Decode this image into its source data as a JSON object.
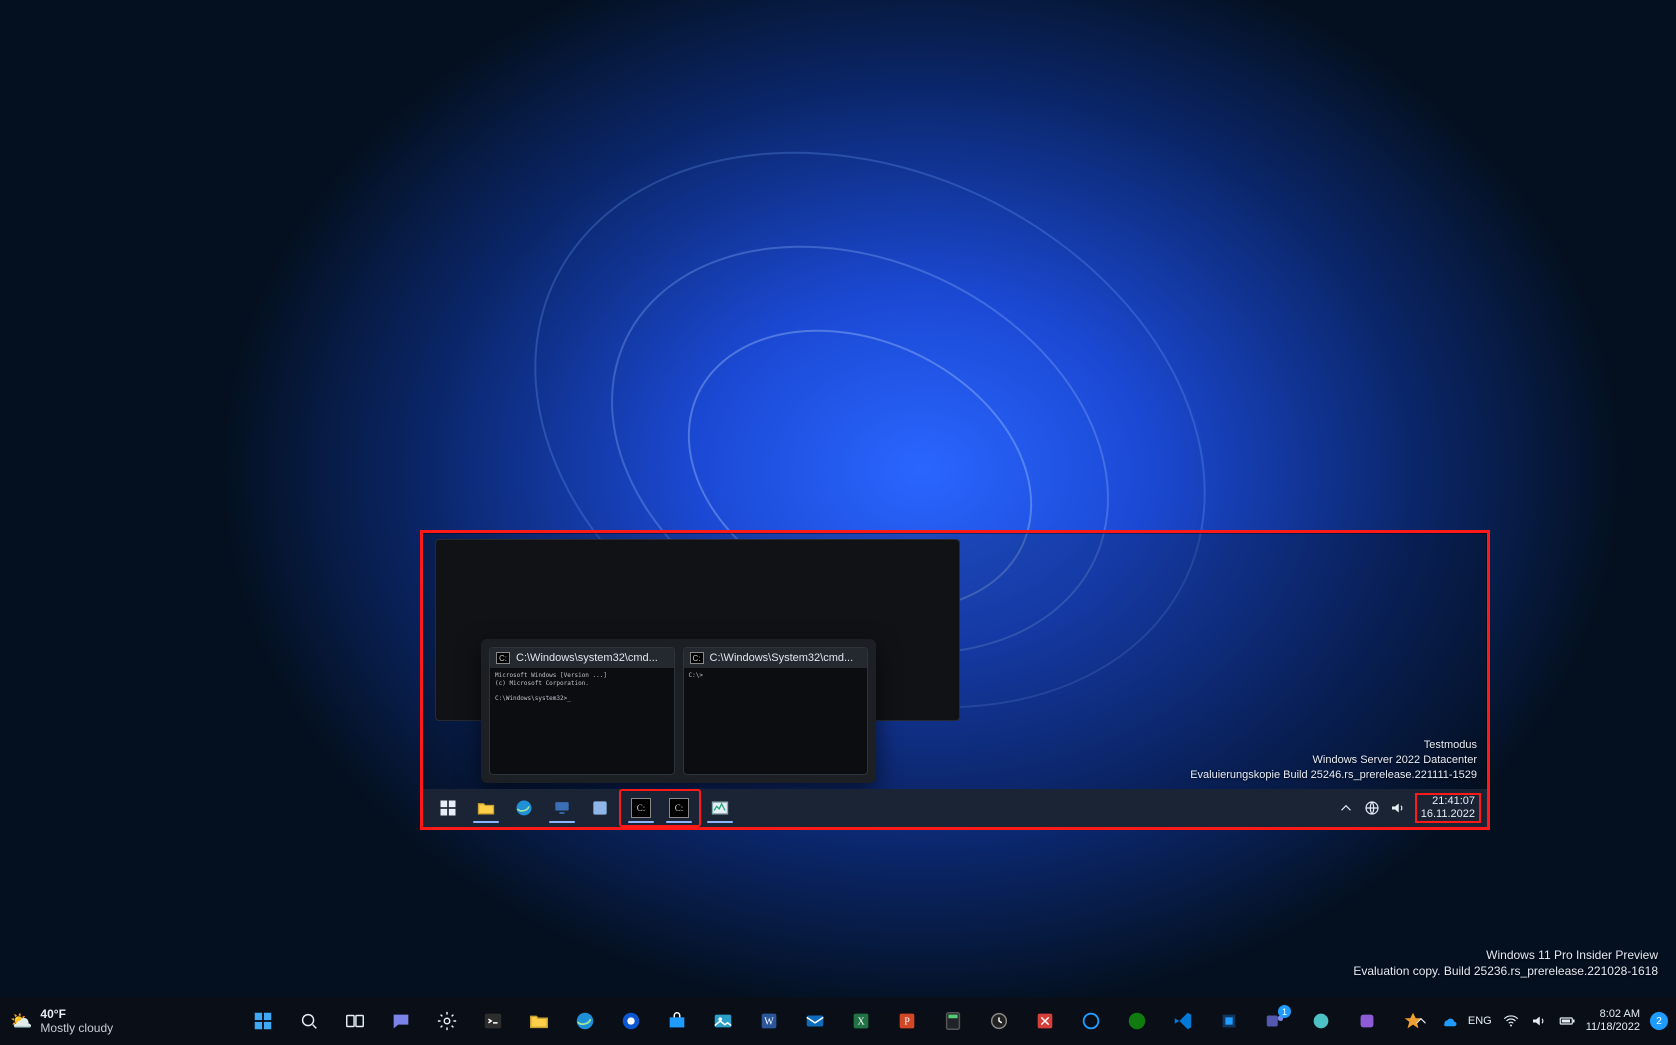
{
  "host": {
    "weather_temp": "40°F",
    "weather_desc": "Mostly cloudy",
    "watermark_line1": "Windows 11 Pro Insider Preview",
    "watermark_line2": "Evaluation copy. Build 25236.rs_prerelease.221028-1618",
    "tray": {
      "lang": "ENG",
      "time": "8:02 AM",
      "date": "11/18/2022",
      "notif_count": "2",
      "teams_badge": "1"
    },
    "apps": [
      "start",
      "search",
      "task-view",
      "chat",
      "widgets",
      "settings",
      "terminal",
      "explorer",
      "edge",
      "mail",
      "store",
      "teams",
      "word",
      "excel",
      "powerpoint",
      "calc",
      "clock",
      "snip",
      "vscode",
      "cortana",
      "xbox",
      "virtualbox",
      "spotify",
      "onedrive",
      "onenote",
      "people"
    ]
  },
  "inner": {
    "watermark_line1": "Testmodus",
    "watermark_line2": "Windows Server 2022 Datacenter",
    "watermark_line3": "Evaluierungskopie Build 25246.rs_prerelease.221111-1529",
    "clock_time": "21:41:07",
    "clock_date": "16.11.2022",
    "preview1_title": "C:\\Windows\\system32\\cmd...",
    "preview2_title": "C:\\Windows\\System32\\cmd..."
  }
}
